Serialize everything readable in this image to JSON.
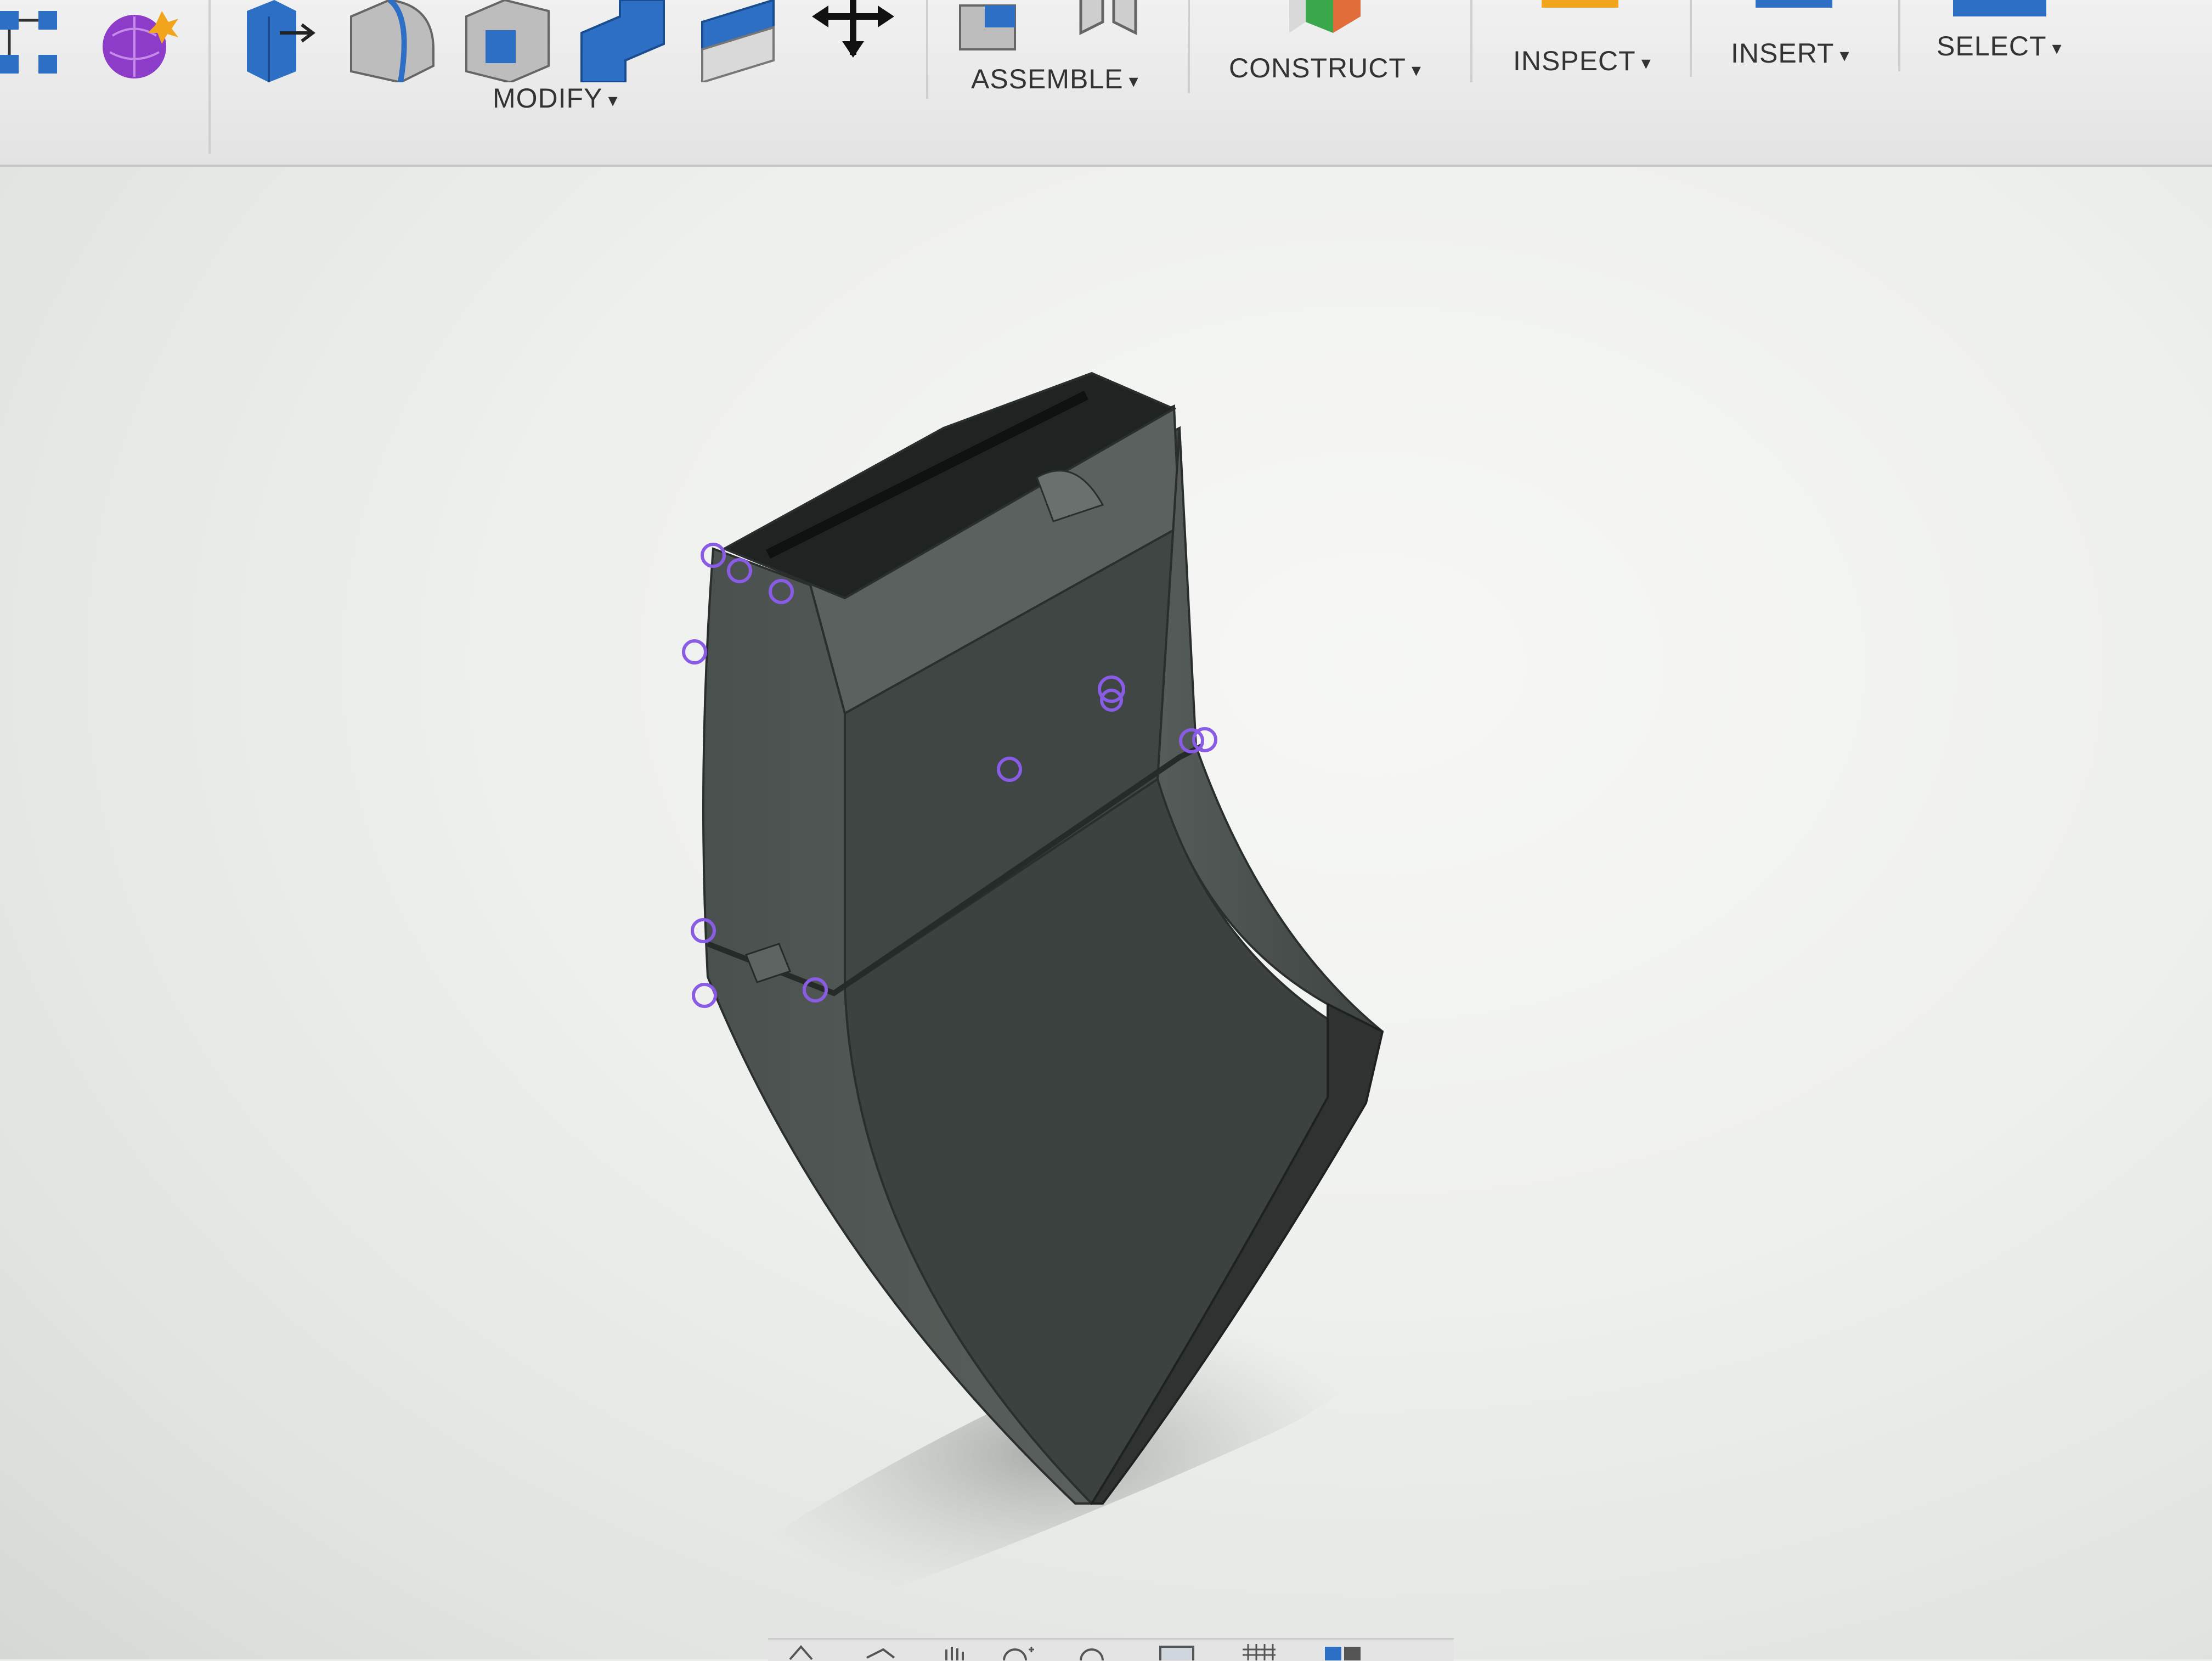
{
  "toolbar": {
    "groups": [
      {
        "label": "MODIFY"
      },
      {
        "label": "ASSEMBLE"
      },
      {
        "label": "CONSTRUCT"
      },
      {
        "label": "INSPECT"
      },
      {
        "label": "INSERT"
      },
      {
        "label": "SELECT"
      }
    ],
    "caret": "▾"
  },
  "icons": {
    "toolbar": [
      "sketch-constraint-icon",
      "form-sphere-icon",
      "press-pull-icon",
      "fillet-icon",
      "shell-icon",
      "combine-icon",
      "stack-icon",
      "move-icon",
      "new-component-icon",
      "joint-icon",
      "construct-plane-icon",
      "inspect-icon",
      "insert-icon",
      "select-icon"
    ],
    "navigation": [
      "orbit-icon",
      "look-at-icon",
      "pan-icon",
      "zoom-icon",
      "fit-icon",
      "display-mode-icon",
      "grid-icon",
      "viewports-icon"
    ]
  },
  "colors": {
    "accent_blue": "#2d6fc4",
    "selection_purple": "#8a5ce6",
    "model_body": "#4d5350",
    "model_face": "#3a403e"
  }
}
